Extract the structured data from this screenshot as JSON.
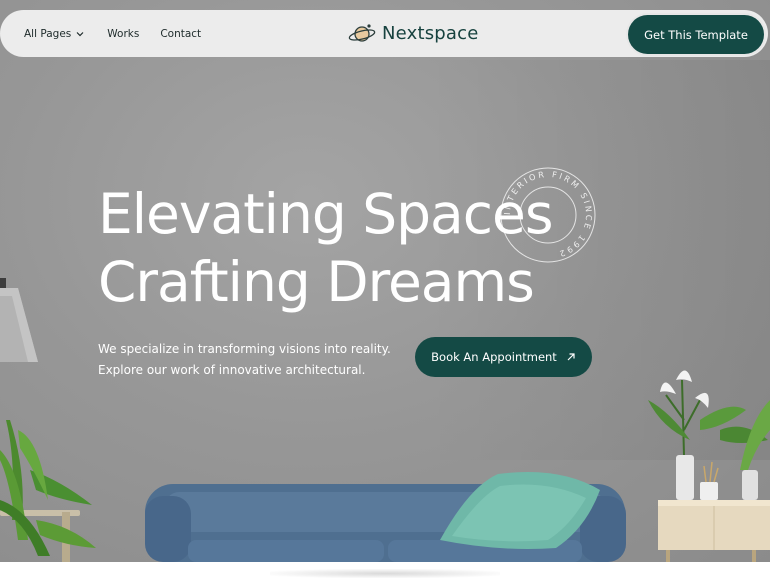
{
  "nav": {
    "links": [
      {
        "label": "All Pages",
        "has_dropdown": true
      },
      {
        "label": "Works"
      },
      {
        "label": "Contact"
      }
    ],
    "brand_name": "Nextspace",
    "cta_label": "Get This Template"
  },
  "hero": {
    "headline_line1": "Elevating Spaces",
    "headline_line2": "Crafting Dreams",
    "badge_text": "INTERIOR FIRM SINCE 1992",
    "subtext_line1": "We specialize in transforming visions into reality.",
    "subtext_line2": "Explore our work of innovative architectural.",
    "button_label": "Book An Appointment",
    "button_icon": "arrow-up-right-icon"
  },
  "colors": {
    "accent": "#144a45",
    "sofa": "#4f6f90",
    "pillow": "#6fb8a8",
    "text_light": "#ffffff",
    "nav_bg": "#ececec"
  }
}
